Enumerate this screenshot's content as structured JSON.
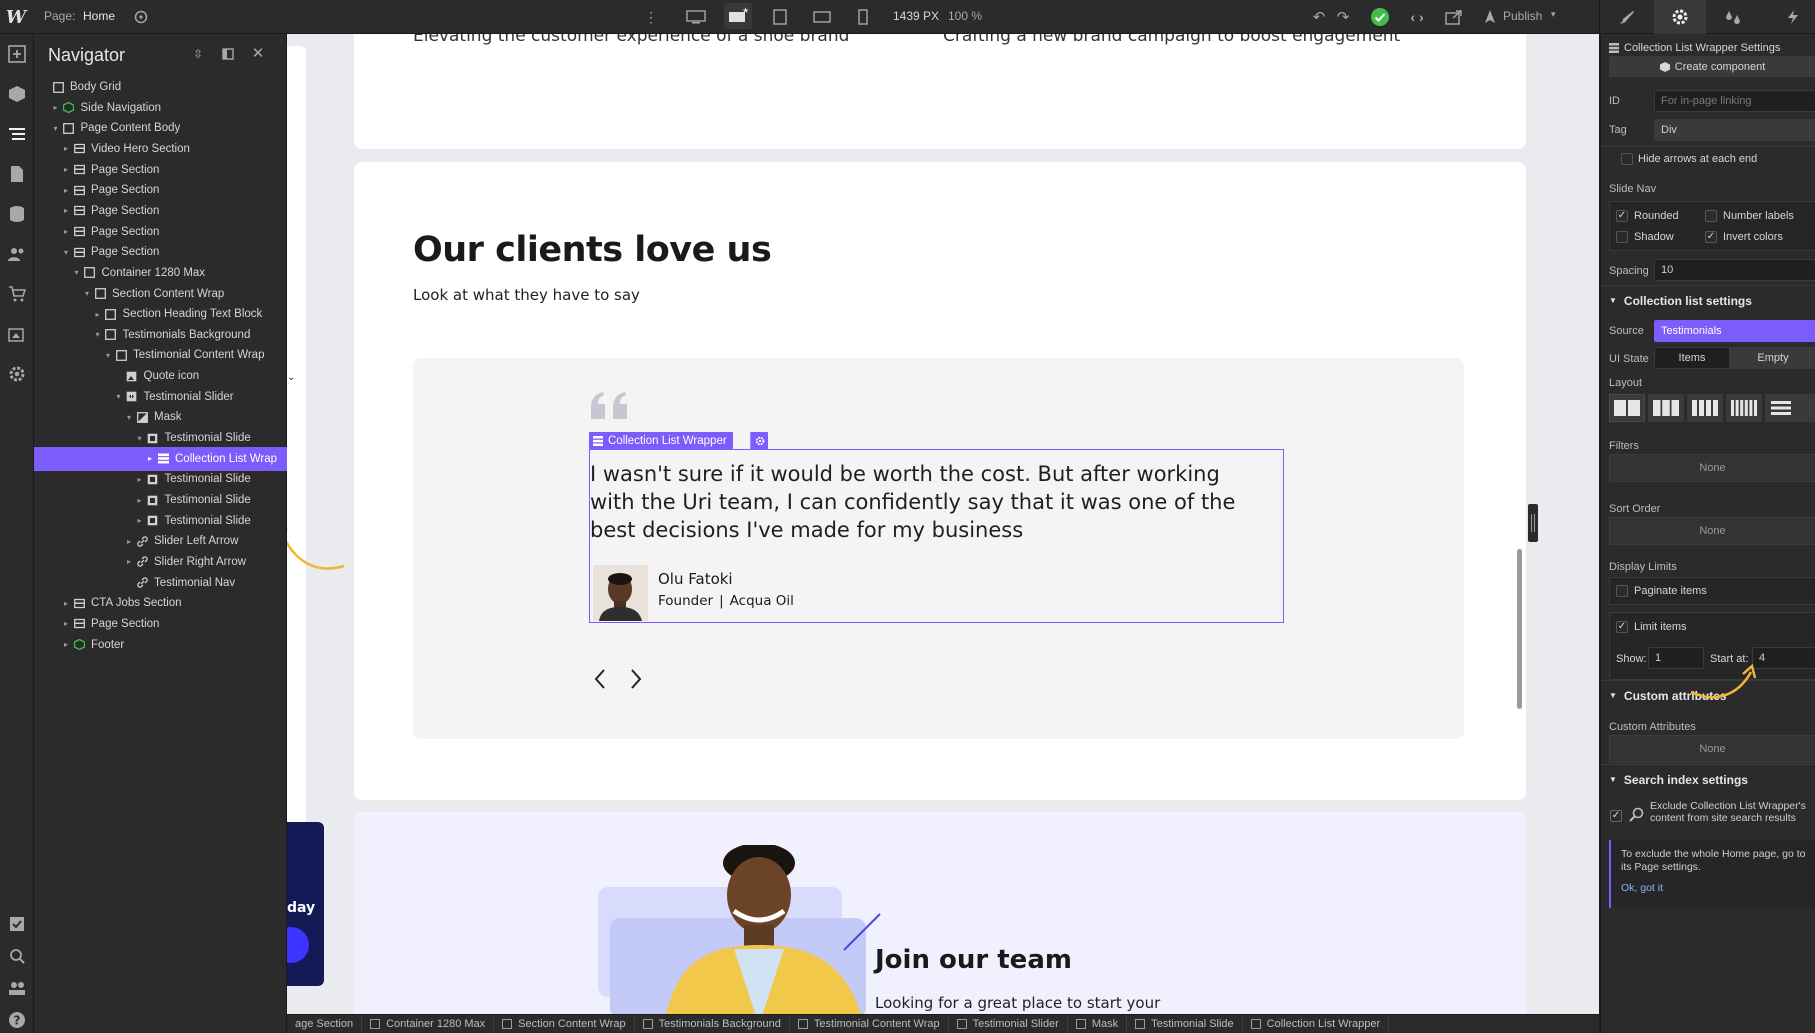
{
  "topbar": {
    "page_label": "Page:",
    "page_name": "Home",
    "width_readout": "1439 PX",
    "zoom_readout": "100 %",
    "publish_label": "Publish"
  },
  "navigator": {
    "title": "Navigator",
    "items": [
      {
        "label": "Body Grid",
        "depth": 0,
        "caret": "",
        "icon": "box"
      },
      {
        "label": "Side Navigation",
        "depth": 1,
        "caret": "▸",
        "icon": "component"
      },
      {
        "label": "Page Content Body",
        "depth": 1,
        "caret": "▾",
        "icon": "box"
      },
      {
        "label": "Video Hero Section",
        "depth": 2,
        "caret": "▸",
        "icon": "section"
      },
      {
        "label": "Page Section",
        "depth": 2,
        "caret": "▸",
        "icon": "section"
      },
      {
        "label": "Page Section",
        "depth": 2,
        "caret": "▸",
        "icon": "section"
      },
      {
        "label": "Page Section",
        "depth": 2,
        "caret": "▸",
        "icon": "section"
      },
      {
        "label": "Page Section",
        "depth": 2,
        "caret": "▸",
        "icon": "section"
      },
      {
        "label": "Page Section",
        "depth": 2,
        "caret": "▾",
        "icon": "section"
      },
      {
        "label": "Container 1280 Max",
        "depth": 3,
        "caret": "▾",
        "icon": "box"
      },
      {
        "label": "Section Content Wrap",
        "depth": 4,
        "caret": "▾",
        "icon": "box"
      },
      {
        "label": "Section Heading Text Block",
        "depth": 5,
        "caret": "▸",
        "icon": "box"
      },
      {
        "label": "Testimonials Background",
        "depth": 5,
        "caret": "▾",
        "icon": "box"
      },
      {
        "label": "Testimonial Content Wrap",
        "depth": 6,
        "caret": "▾",
        "icon": "box"
      },
      {
        "label": "Quote icon",
        "depth": 7,
        "caret": "",
        "icon": "image"
      },
      {
        "label": "Testimonial Slider",
        "depth": 7,
        "caret": "▾",
        "icon": "slider"
      },
      {
        "label": "Mask",
        "depth": 8,
        "caret": "▾",
        "icon": "mask"
      },
      {
        "label": "Testimonial Slide",
        "depth": 9,
        "caret": "▾",
        "icon": "slide"
      },
      {
        "label": "Collection List Wrap",
        "depth": 10,
        "caret": "▸",
        "icon": "collection",
        "selected": true
      },
      {
        "label": "Testimonial Slide",
        "depth": 9,
        "caret": "▸",
        "icon": "slide"
      },
      {
        "label": "Testimonial Slide",
        "depth": 9,
        "caret": "▸",
        "icon": "slide"
      },
      {
        "label": "Testimonial Slide",
        "depth": 9,
        "caret": "▸",
        "icon": "slide"
      },
      {
        "label": "Slider Left Arrow",
        "depth": 8,
        "caret": "▸",
        "icon": "link"
      },
      {
        "label": "Slider Right Arrow",
        "depth": 8,
        "caret": "▸",
        "icon": "link"
      },
      {
        "label": "Testimonial Nav",
        "depth": 8,
        "caret": "",
        "icon": "link"
      },
      {
        "label": "CTA Jobs Section",
        "depth": 2,
        "caret": "▸",
        "icon": "section"
      },
      {
        "label": "Page Section",
        "depth": 2,
        "caret": "▸",
        "icon": "section"
      },
      {
        "label": "Footer",
        "depth": 2,
        "caret": "▸",
        "icon": "component"
      }
    ]
  },
  "canvas": {
    "top_card_left_text": "Elevating the customer experience of a shoe brand",
    "top_card_right_text": "Crafting a new brand campaign to boost engagement",
    "testimonials_heading": "Our clients love us",
    "testimonials_subheading": "Look at what they have to say",
    "selection_badge": "Collection List Wrapper",
    "quote_text": "I wasn't sure if it would be worth the cost. But after working with the Uri team, I can confidently say that it was one of the best decisions I've made for my business",
    "author_name": "Olu Fatoki",
    "author_role": "Founder",
    "author_separator": "|",
    "author_company": "Acqua Oil",
    "side_card_text": "day",
    "join_heading": "Join our team",
    "join_text": "Looking for a great place to start your creative career? Join our team today"
  },
  "right_panel": {
    "settings_title": "Collection List Wrapper Settings",
    "create_component": "Create component",
    "id_label": "ID",
    "id_placeholder": "For in-page linking",
    "tag_label": "Tag",
    "tag_value": "Div",
    "hide_arrows_label": "Hide arrows at each end",
    "slide_nav_label": "Slide Nav",
    "rounded_label": "Rounded",
    "number_labels_label": "Number labels",
    "shadow_label": "Shadow",
    "invert_colors_label": "Invert colors",
    "spacing_label": "Spacing",
    "spacing_value": "10",
    "collection_settings_title": "Collection list settings",
    "source_label": "Source",
    "source_value": "Testimonials",
    "ui_state_label": "UI State",
    "ui_state_items": "Items",
    "ui_state_empty": "Empty",
    "layout_label": "Layout",
    "filters_label": "Filters",
    "filters_value": "None",
    "sort_order_label": "Sort Order",
    "sort_order_value": "None",
    "display_limits_label": "Display Limits",
    "paginate_label": "Paginate items",
    "limit_items_label": "Limit items",
    "show_label": "Show:",
    "show_value": "1",
    "start_at_label": "Start at:",
    "start_at_value": "4",
    "custom_attrs_title": "Custom attributes",
    "custom_attrs_label": "Custom Attributes",
    "custom_attrs_value": "None",
    "search_index_title": "Search index settings",
    "exclude_text": "Exclude Collection List Wrapper's content from site search results",
    "exclude_note": "To exclude the whole Home page, go to its Page settings.",
    "ok_got_it": "Ok, got it"
  },
  "breadcrumb": [
    "age Section",
    "Container 1280 Max",
    "Section Content Wrap",
    "Testimonials Background",
    "Testimonial Content Wrap",
    "Testimonial Slider",
    "Mask",
    "Testimonial Slide",
    "Collection List Wrapper"
  ],
  "colors": {
    "accent": "#7c5cfa",
    "success": "#3fbf4a",
    "panel_bg": "#2b2b2b",
    "canvas_bg": "#e9ebee",
    "annotation_arrow": "#f2b53a"
  }
}
